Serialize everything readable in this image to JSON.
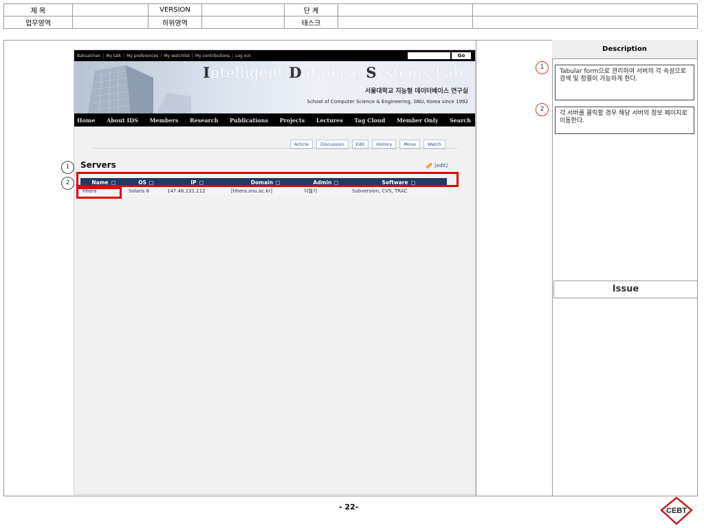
{
  "meta": {
    "row1": [
      "제 목",
      "",
      "VERSION",
      "",
      "단 계",
      "",
      ""
    ],
    "row2": [
      "업무영역",
      "",
      "하위영역",
      "",
      "태스크",
      "",
      ""
    ]
  },
  "wiki": {
    "topbar": [
      "Baksalchan",
      "My talk",
      "My preferences",
      "My watchlist",
      "My contributions",
      "Log out"
    ],
    "go_label": "Go",
    "lab_title": {
      "i": "I",
      "ntelligent": "ntelligent ",
      "d": "D",
      "atabase": "atabase ",
      "s": "S",
      "ystems": "ystems Lab."
    },
    "lab_kr": "서울대학교 지능형 데이터베이스 연구실",
    "lab_en": "School of Computer Science & Engineering, SNU, Korea since 1992",
    "nav": [
      "Home",
      "About IDS",
      "Members",
      "Research",
      "Publications",
      "Projects",
      "Lectures",
      "Tag Cloud",
      "Member Only",
      "Search"
    ],
    "tabs": [
      "Article",
      "Discussion",
      "Edit",
      "History",
      "Move",
      "Watch"
    ],
    "page_title": "Servers",
    "edit_label": "[edit]",
    "table": {
      "headers": [
        "Name",
        "OS",
        "IP",
        "Domain",
        "Admin",
        "Software"
      ],
      "rows": [
        [
          "hhera",
          "Solaris 8",
          "147.46.231.112",
          "[hhera.snu.ac.kr]",
          "이철기",
          "Subversion, CVS, TRAC"
        ]
      ]
    }
  },
  "markers": [
    "1",
    "2"
  ],
  "panel": {
    "description_title": "Description",
    "desc1": "Tabular form으로 관리하여 서버의 각 속성으로 검색 및 정렬이 가능하게 한다.",
    "desc2": "각 서버를 클릭할 경우 해당 서버의 정보 페이지로 이동한다.",
    "issue_title": "Issue"
  },
  "page_number": "- 22-",
  "logo_text": "CEBT",
  "colors": {
    "highlight": "#e00000",
    "table_header": "#1f3a63",
    "nav_bg": "#000000"
  }
}
